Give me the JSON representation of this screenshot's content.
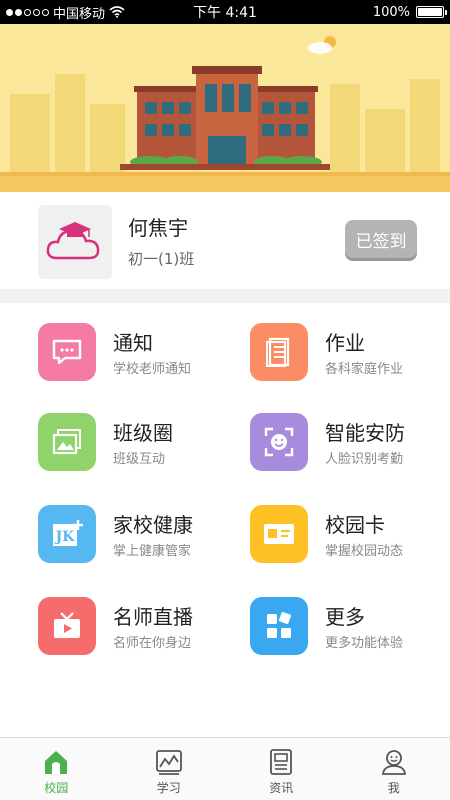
{
  "status_bar": {
    "carrier": "中国移动",
    "time": "下午 4:41",
    "battery": "100%",
    "battery_level": 1.0,
    "signal_bars": 2
  },
  "profile": {
    "name": "何焦宇",
    "class_name": "初一(1)班",
    "checkin_label": "已签到"
  },
  "features": [
    {
      "title": "通知",
      "desc": "学校老师通知",
      "icon": "message-icon",
      "color": "#f47ba3"
    },
    {
      "title": "作业",
      "desc": "各科家庭作业",
      "icon": "document-icon",
      "color": "#fb8c63"
    },
    {
      "title": "班级圈",
      "desc": "班级互动",
      "icon": "photos-icon",
      "color": "#8fd36a"
    },
    {
      "title": "智能安防",
      "desc": "人脸识别考勤",
      "icon": "face-scan-icon",
      "color": "#a98bdd"
    },
    {
      "title": "家校健康",
      "desc": "掌上健康管家",
      "icon": "health-jk-icon",
      "color": "#56b8f0"
    },
    {
      "title": "校园卡",
      "desc": "掌握校园动态",
      "icon": "id-card-icon",
      "color": "#fdc125"
    },
    {
      "title": "名师直播",
      "desc": "名师在你身边",
      "icon": "tv-icon",
      "color": "#f66b6b"
    },
    {
      "title": "更多",
      "desc": "更多功能体验",
      "icon": "apps-icon",
      "color": "#3aa8f0"
    }
  ],
  "nav": [
    {
      "label": "校园",
      "icon": "home-icon",
      "active": true
    },
    {
      "label": "学习",
      "icon": "chart-icon",
      "active": false
    },
    {
      "label": "资讯",
      "icon": "news-icon",
      "active": false
    },
    {
      "label": "我",
      "icon": "user-icon",
      "active": false
    }
  ],
  "colors": {
    "active": "#4caf50",
    "banner": "#fbe79a",
    "inactive": "#555555"
  }
}
